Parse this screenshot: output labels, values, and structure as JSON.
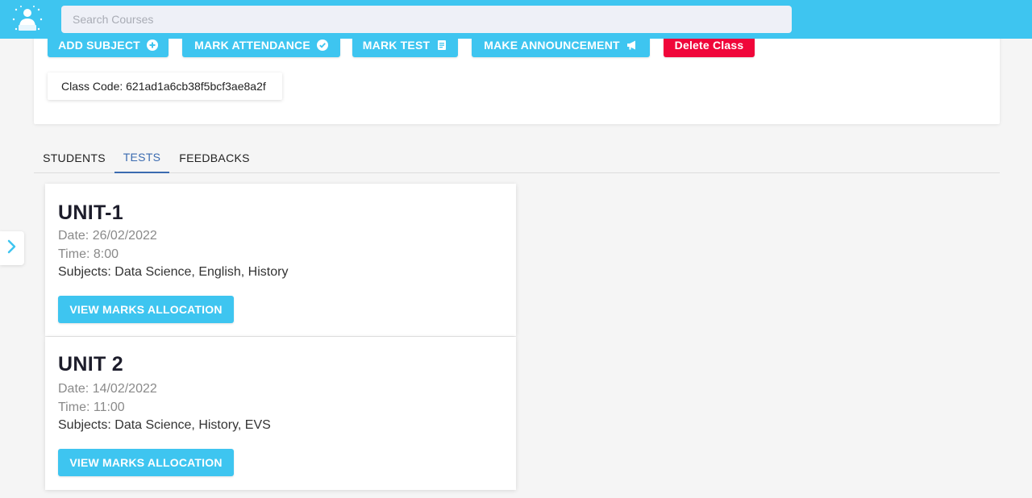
{
  "header": {
    "logo_icon": "student-reading-icon",
    "search_placeholder": "Search Courses",
    "search_value": ""
  },
  "class_actions": {
    "add_subject": "ADD SUBJECT",
    "mark_attendance": "MARK ATTENDANCE",
    "mark_test": "MARK TEST",
    "make_announcement": "MAKE ANNOUNCEMENT",
    "delete_class": "Delete Class",
    "class_code": "Class Code: 621ad1a6cb38f5bcf3ae8a2f"
  },
  "tabs": [
    {
      "label": "STUDENTS",
      "active": false
    },
    {
      "label": "TESTS",
      "active": true
    },
    {
      "label": "FEEDBACKS",
      "active": false
    }
  ],
  "tests": [
    {
      "title": "UNIT-1",
      "date": "Date: 26/02/2022",
      "time": "Time: 8:00",
      "subjects": "Subjects: Data Science, English, History",
      "button": "VIEW MARKS ALLOCATION"
    },
    {
      "title": "UNIT 2",
      "date": "Date: 14/02/2022",
      "time": "Time: 11:00",
      "subjects": "Subjects: Data Science, History, EVS",
      "button": "VIEW MARKS ALLOCATION"
    }
  ],
  "colors": {
    "primary": "#3ec5f0",
    "danger": "#f0063a",
    "active_tab": "#3b6bb0"
  }
}
